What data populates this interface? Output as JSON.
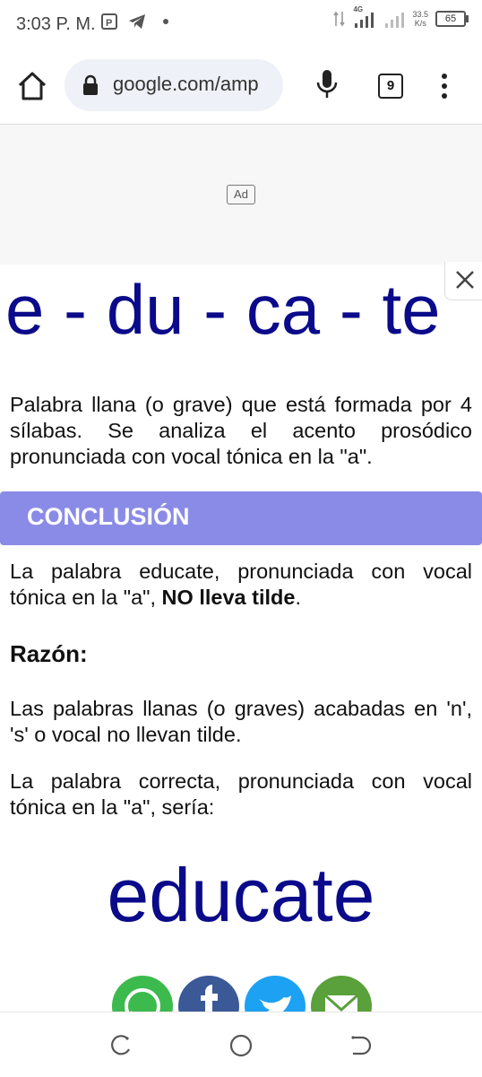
{
  "status_bar": {
    "time": "3:03 P. M.",
    "network": "4G",
    "speed_value": "33.5",
    "speed_unit": "K/s",
    "battery": "65"
  },
  "browser": {
    "url": "google.com/amp",
    "tab_count": "9"
  },
  "ad": {
    "badge": "Ad"
  },
  "article": {
    "syllables": "e - du - ca - te",
    "description": "Palabra llana (o grave) que está formada por 4 sílabas. Se analiza el acento prosódico pronunciada con vocal tónica en la \"a\".",
    "conclusion_heading": "CONCLUSIÓN",
    "conclusion_text_start": "La palabra educate, pronunciada con vocal tónica en la \"a\", ",
    "conclusion_text_bold": "NO lleva tilde",
    "conclusion_text_end": ".",
    "reason_heading": "Razón:",
    "reason_text": "Las palabras llanas (o graves) acabadas en 'n', 's' o vocal no llevan tilde.",
    "correct_text": "La palabra correcta, pronunciada con vocal tónica en la \"a\", sería:",
    "correct_word": "educate"
  },
  "share_icons": [
    "whatsapp-icon",
    "facebook-icon",
    "twitter-icon",
    "email-icon"
  ],
  "colors": {
    "accent_blue": "#0a0a8a",
    "conclusion_bar": "#8a8be6"
  }
}
